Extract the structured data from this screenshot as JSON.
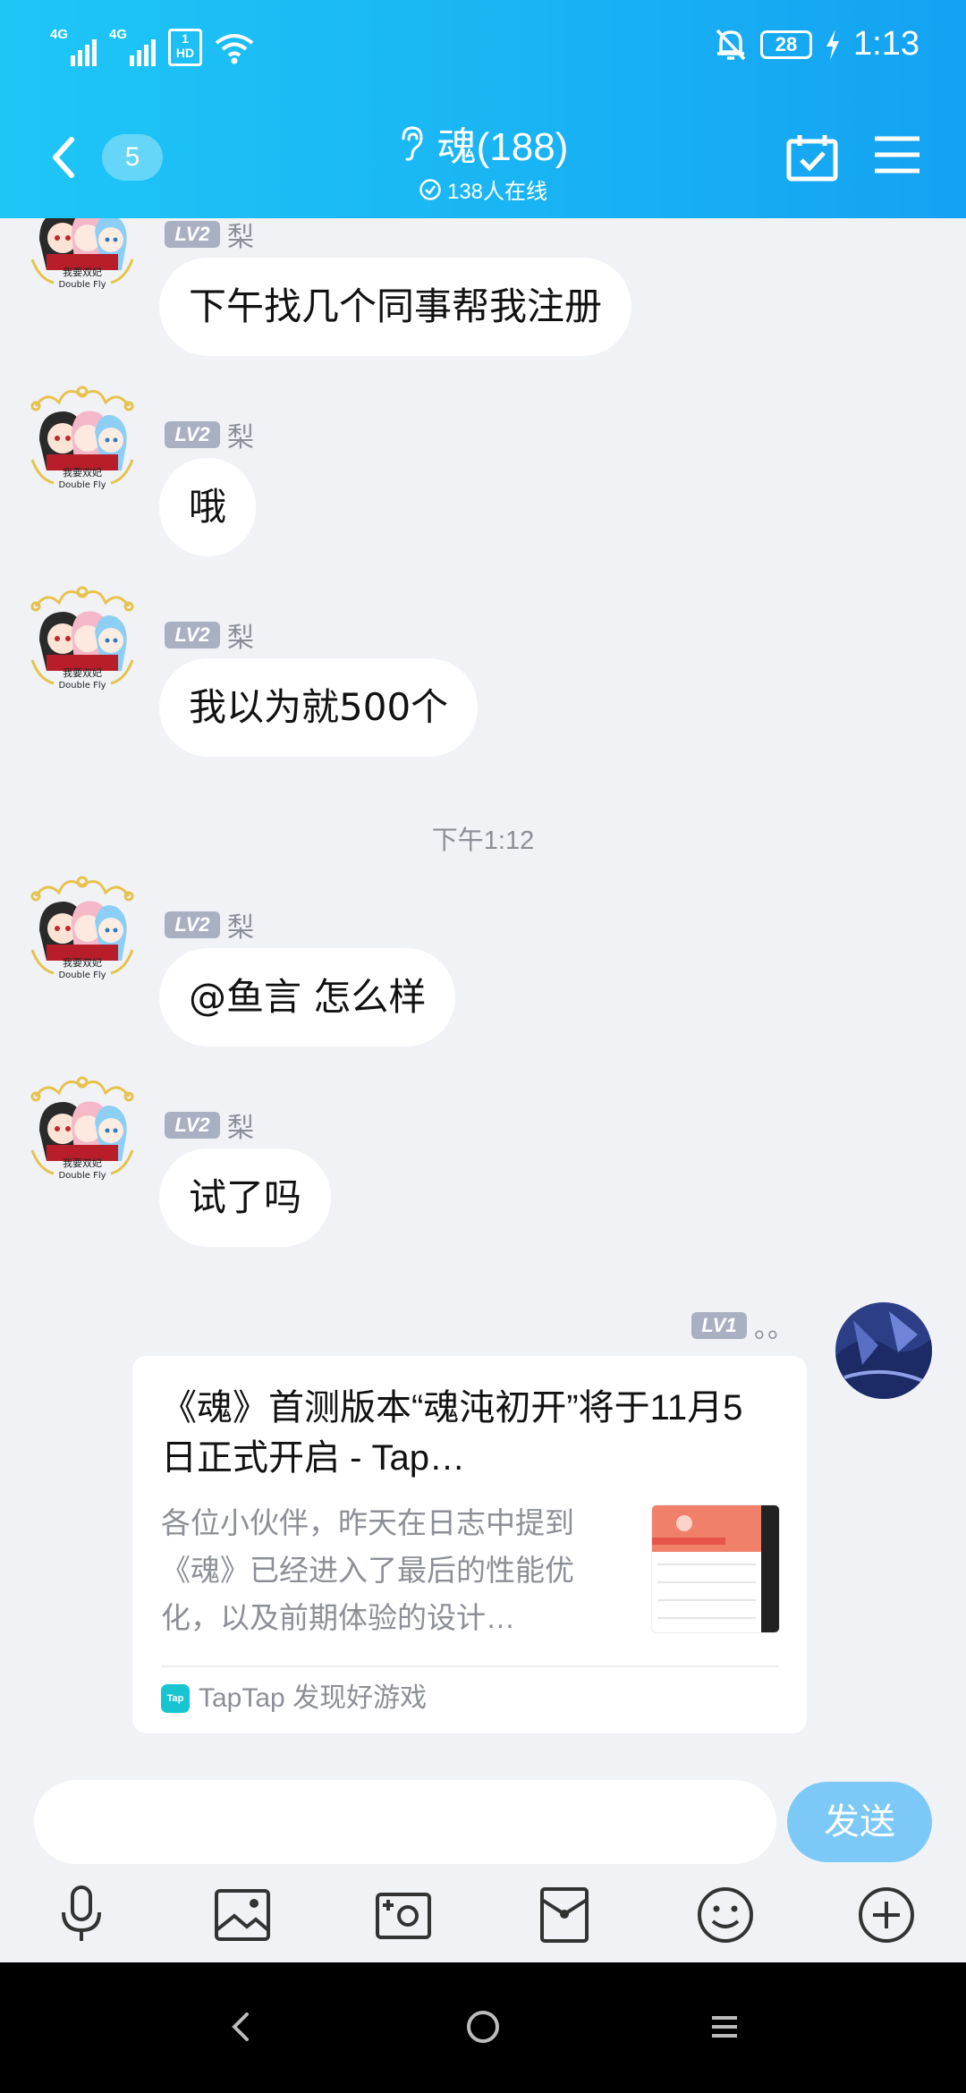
{
  "status_bar": {
    "network1": "4G",
    "network2": "4G",
    "hd_badge_top": "1",
    "hd_badge_bottom": "HD",
    "battery": "28",
    "time": "1:13"
  },
  "header": {
    "back_count": "5",
    "title": "魂(188)",
    "online_status": "138人在线"
  },
  "messages": [
    {
      "level": "LV2",
      "nickname": "梨",
      "text": "下午找几个同事帮我注册"
    },
    {
      "level": "LV2",
      "nickname": "梨",
      "text": "哦"
    },
    {
      "level": "LV2",
      "nickname": "梨",
      "text": "我以为就500个"
    },
    {
      "level": "LV2",
      "nickname": "梨",
      "text": "@鱼言 怎么样"
    },
    {
      "level": "LV2",
      "nickname": "梨",
      "text": "试了吗"
    }
  ],
  "time_separator": "下午1:12",
  "self_message": {
    "level": "LV1",
    "nickname": "。。",
    "card": {
      "title": "《魂》首测版本“魂沌初开”将于11月5日正式开启 - Tap…",
      "description": "各位小伙伴，昨天在日志中提到《魂》已经进入了最后的性能优化，以及前期体验的设计…",
      "source_logo_text": "Tap",
      "source": "TapTap 发现好游戏"
    }
  },
  "avatar_caption": {
    "line1": "我要双妃",
    "line2": "Double Fly"
  },
  "input": {
    "value": "",
    "placeholder": "",
    "send_label": "发送"
  },
  "colors": {
    "header_start": "#1ec6f6",
    "header_end": "#14a2f2",
    "send_button": "#7cc9f7",
    "level_badge": "#a9b0c2",
    "chat_background": "#f1f2f6"
  },
  "icons": {
    "toolbar": [
      "microphone-icon",
      "image-icon",
      "camera-icon",
      "red-packet-icon",
      "emoji-icon",
      "plus-icon"
    ],
    "navigation": [
      "nav-back-icon",
      "nav-home-icon",
      "nav-menu-icon"
    ]
  }
}
